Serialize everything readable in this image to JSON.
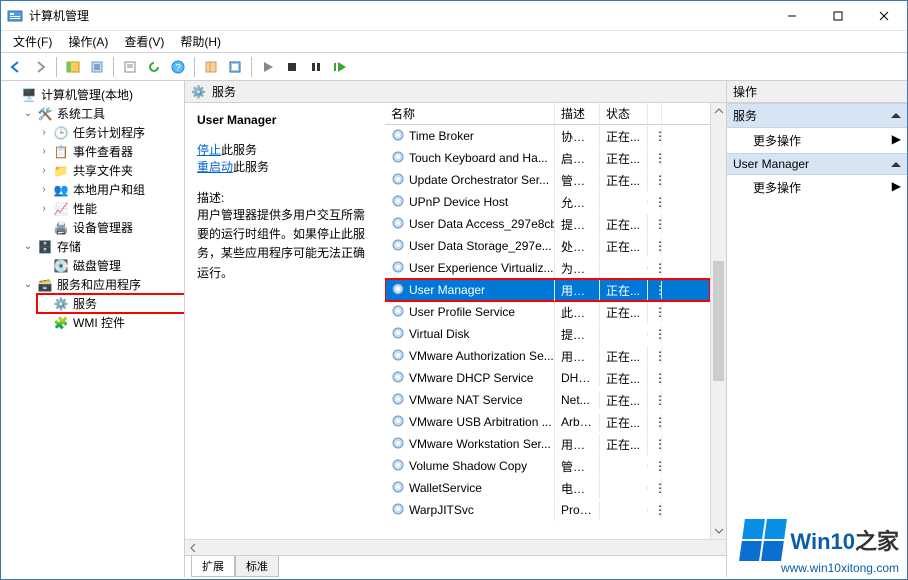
{
  "title": "计算机管理",
  "menus": {
    "file": "文件(F)",
    "action": "操作(A)",
    "view": "查看(V)",
    "help": "帮助(H)"
  },
  "tree": {
    "root": "计算机管理(本地)",
    "systools": "系统工具",
    "sched": "任务计划程序",
    "eventvwr": "事件查看器",
    "shared": "共享文件夹",
    "localusers": "本地用户和组",
    "perf": "性能",
    "devmgr": "设备管理器",
    "storage": "存储",
    "diskmgr": "磁盘管理",
    "svcsapps": "服务和应用程序",
    "services": "服务",
    "wmi": "WMI 控件"
  },
  "center": {
    "header": "服务",
    "selected_title": "User Manager",
    "stop": "停止",
    "stop_suffix": "此服务",
    "restart": "重启动",
    "restart_suffix": "此服务",
    "desc_label": "描述:",
    "desc_text": "用户管理器提供多用户交互所需要的运行时组件。如果停止此服务，某些应用程序可能无法正确运行。",
    "cols": {
      "name": "名称",
      "desc": "描述",
      "status": "状态"
    },
    "tabs": {
      "extended": "扩展",
      "standard": "标准"
    }
  },
  "services": [
    {
      "name": "Time Broker",
      "desc": "协调...",
      "status": "正在..."
    },
    {
      "name": "Touch Keyboard and Ha...",
      "desc": "启用...",
      "status": "正在..."
    },
    {
      "name": "Update Orchestrator Ser...",
      "desc": "管理...",
      "status": "正在..."
    },
    {
      "name": "UPnP Device Host",
      "desc": "允许...",
      "status": ""
    },
    {
      "name": "User Data Access_297e8cb",
      "desc": "提供...",
      "status": "正在..."
    },
    {
      "name": "User Data Storage_297e...",
      "desc": "处理...",
      "status": "正在..."
    },
    {
      "name": "User Experience Virtualiz...",
      "desc": "为应...",
      "status": ""
    },
    {
      "name": "User Manager",
      "desc": "用户...",
      "status": "正在...",
      "selected": true
    },
    {
      "name": "User Profile Service",
      "desc": "此服...",
      "status": "正在..."
    },
    {
      "name": "Virtual Disk",
      "desc": "提供...",
      "status": ""
    },
    {
      "name": "VMware Authorization Se...",
      "desc": "用于...",
      "status": "正在..."
    },
    {
      "name": "VMware DHCP Service",
      "desc": "DHC...",
      "status": "正在..."
    },
    {
      "name": "VMware NAT Service",
      "desc": "Net...",
      "status": "正在..."
    },
    {
      "name": "VMware USB Arbitration ...",
      "desc": "Arbit...",
      "status": "正在..."
    },
    {
      "name": "VMware Workstation Ser...",
      "desc": "用于...",
      "status": "正在..."
    },
    {
      "name": "Volume Shadow Copy",
      "desc": "管理...",
      "status": ""
    },
    {
      "name": "WalletService",
      "desc": "电子...",
      "status": ""
    },
    {
      "name": "WarpJITSvc",
      "desc": "Prov...",
      "status": ""
    }
  ],
  "actions": {
    "pane_title": "操作",
    "services": "服务",
    "more": "更多操作",
    "usermanager": "User Manager"
  },
  "watermark": {
    "brand": "Win10",
    "brand_suffix": "之家",
    "url": "www.win10xitong.com"
  }
}
